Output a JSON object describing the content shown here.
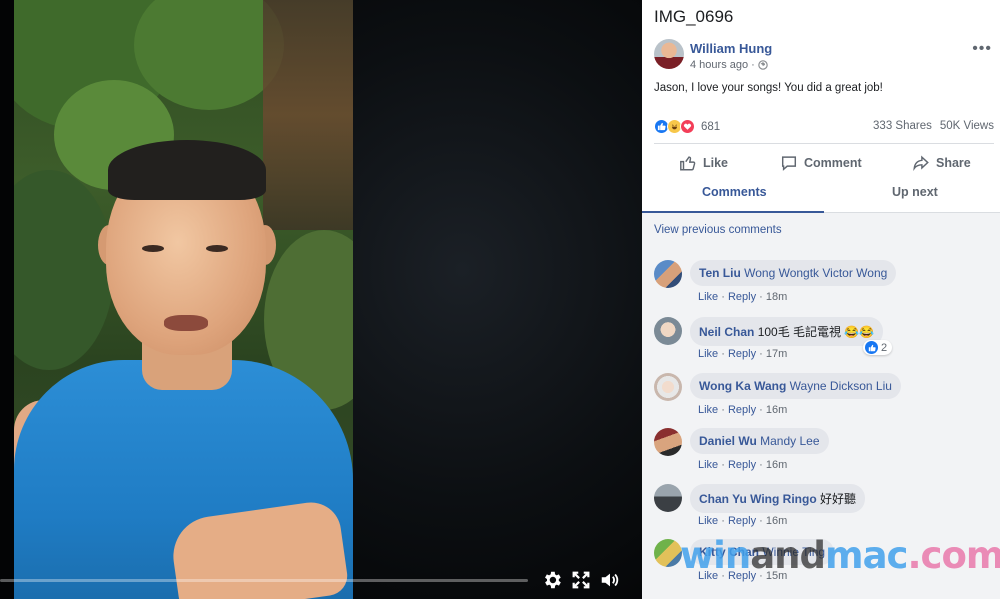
{
  "video": {
    "progress": 0.0,
    "controls": [
      "settings-icon",
      "fullscreen-icon",
      "volume-icon"
    ]
  },
  "post": {
    "title": "IMG_0696",
    "author": "William Hung",
    "time": "4 hours ago",
    "separator": "·",
    "text": "Jason, I love your songs! You did a great job!",
    "reaction_count": "681",
    "shares": "333 Shares",
    "views": "50K Views"
  },
  "actions": {
    "like": "Like",
    "comment": "Comment",
    "share": "Share"
  },
  "tabs": {
    "comments": "Comments",
    "up_next": "Up next"
  },
  "comments_section": {
    "view_previous": "View previous comments",
    "items": [
      {
        "author": "Ten Liu",
        "text": "Wong Wongtk Victor Wong",
        "like": "Like",
        "reply": "Reply",
        "time": "18m",
        "likes": ""
      },
      {
        "author": "Neil Chan",
        "text": "100毛 毛記電視 😂😂",
        "like": "Like",
        "reply": "Reply",
        "time": "17m",
        "likes": "2"
      },
      {
        "author": "Wong Ka Wang",
        "text": "Wayne Dickson Liu",
        "like": "Like",
        "reply": "Reply",
        "time": "16m",
        "likes": ""
      },
      {
        "author": "Daniel Wu",
        "text": "Mandy Lee",
        "like": "Like",
        "reply": "Reply",
        "time": "16m",
        "likes": ""
      },
      {
        "author": "Chan Yu Wing Ringo",
        "text": "好好聽",
        "like": "Like",
        "reply": "Reply",
        "time": "16m",
        "likes": ""
      },
      {
        "author": "Kitty Chan",
        "text": "Winnie Ting",
        "like": "Like",
        "reply": "Reply",
        "time": "15m",
        "likes": ""
      }
    ]
  },
  "watermark": {
    "part1": "win",
    "part2": "and",
    "part3": "mac",
    "part4": ".com"
  },
  "colors": {
    "link_blue": "#385898",
    "shirt_blue": "#2c8ed6",
    "like_blue": "#1877f2",
    "love_red": "#f33e58"
  }
}
